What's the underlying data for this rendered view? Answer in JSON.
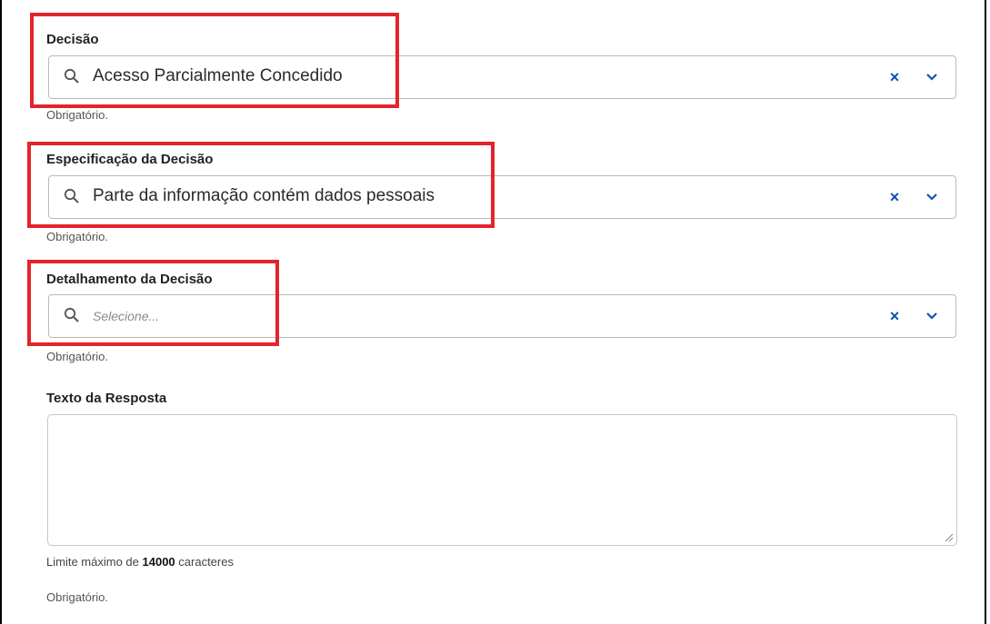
{
  "fields": {
    "decision": {
      "label": "Decisão",
      "value": "Acesso Parcialmente Concedido",
      "hint": "Obrigatório."
    },
    "specification": {
      "label": "Especificação da Decisão",
      "value": "Parte da informação contém dados pessoais",
      "hint": "Obrigatório."
    },
    "detail": {
      "label": "Detalhamento da Decisão",
      "placeholder": "Selecione...",
      "hint": "Obrigatório."
    }
  },
  "response": {
    "label": "Texto da Resposta",
    "limit_prefix": "Limite máximo de",
    "limit_value": "14000",
    "limit_suffix": "caracteres",
    "hint": "Obrigatório."
  },
  "icons": {
    "clear": "×",
    "search": "search-icon",
    "dropdown": "chevron-down-icon"
  },
  "colors": {
    "accent": "#1351b4",
    "highlight": "#e3242b"
  }
}
